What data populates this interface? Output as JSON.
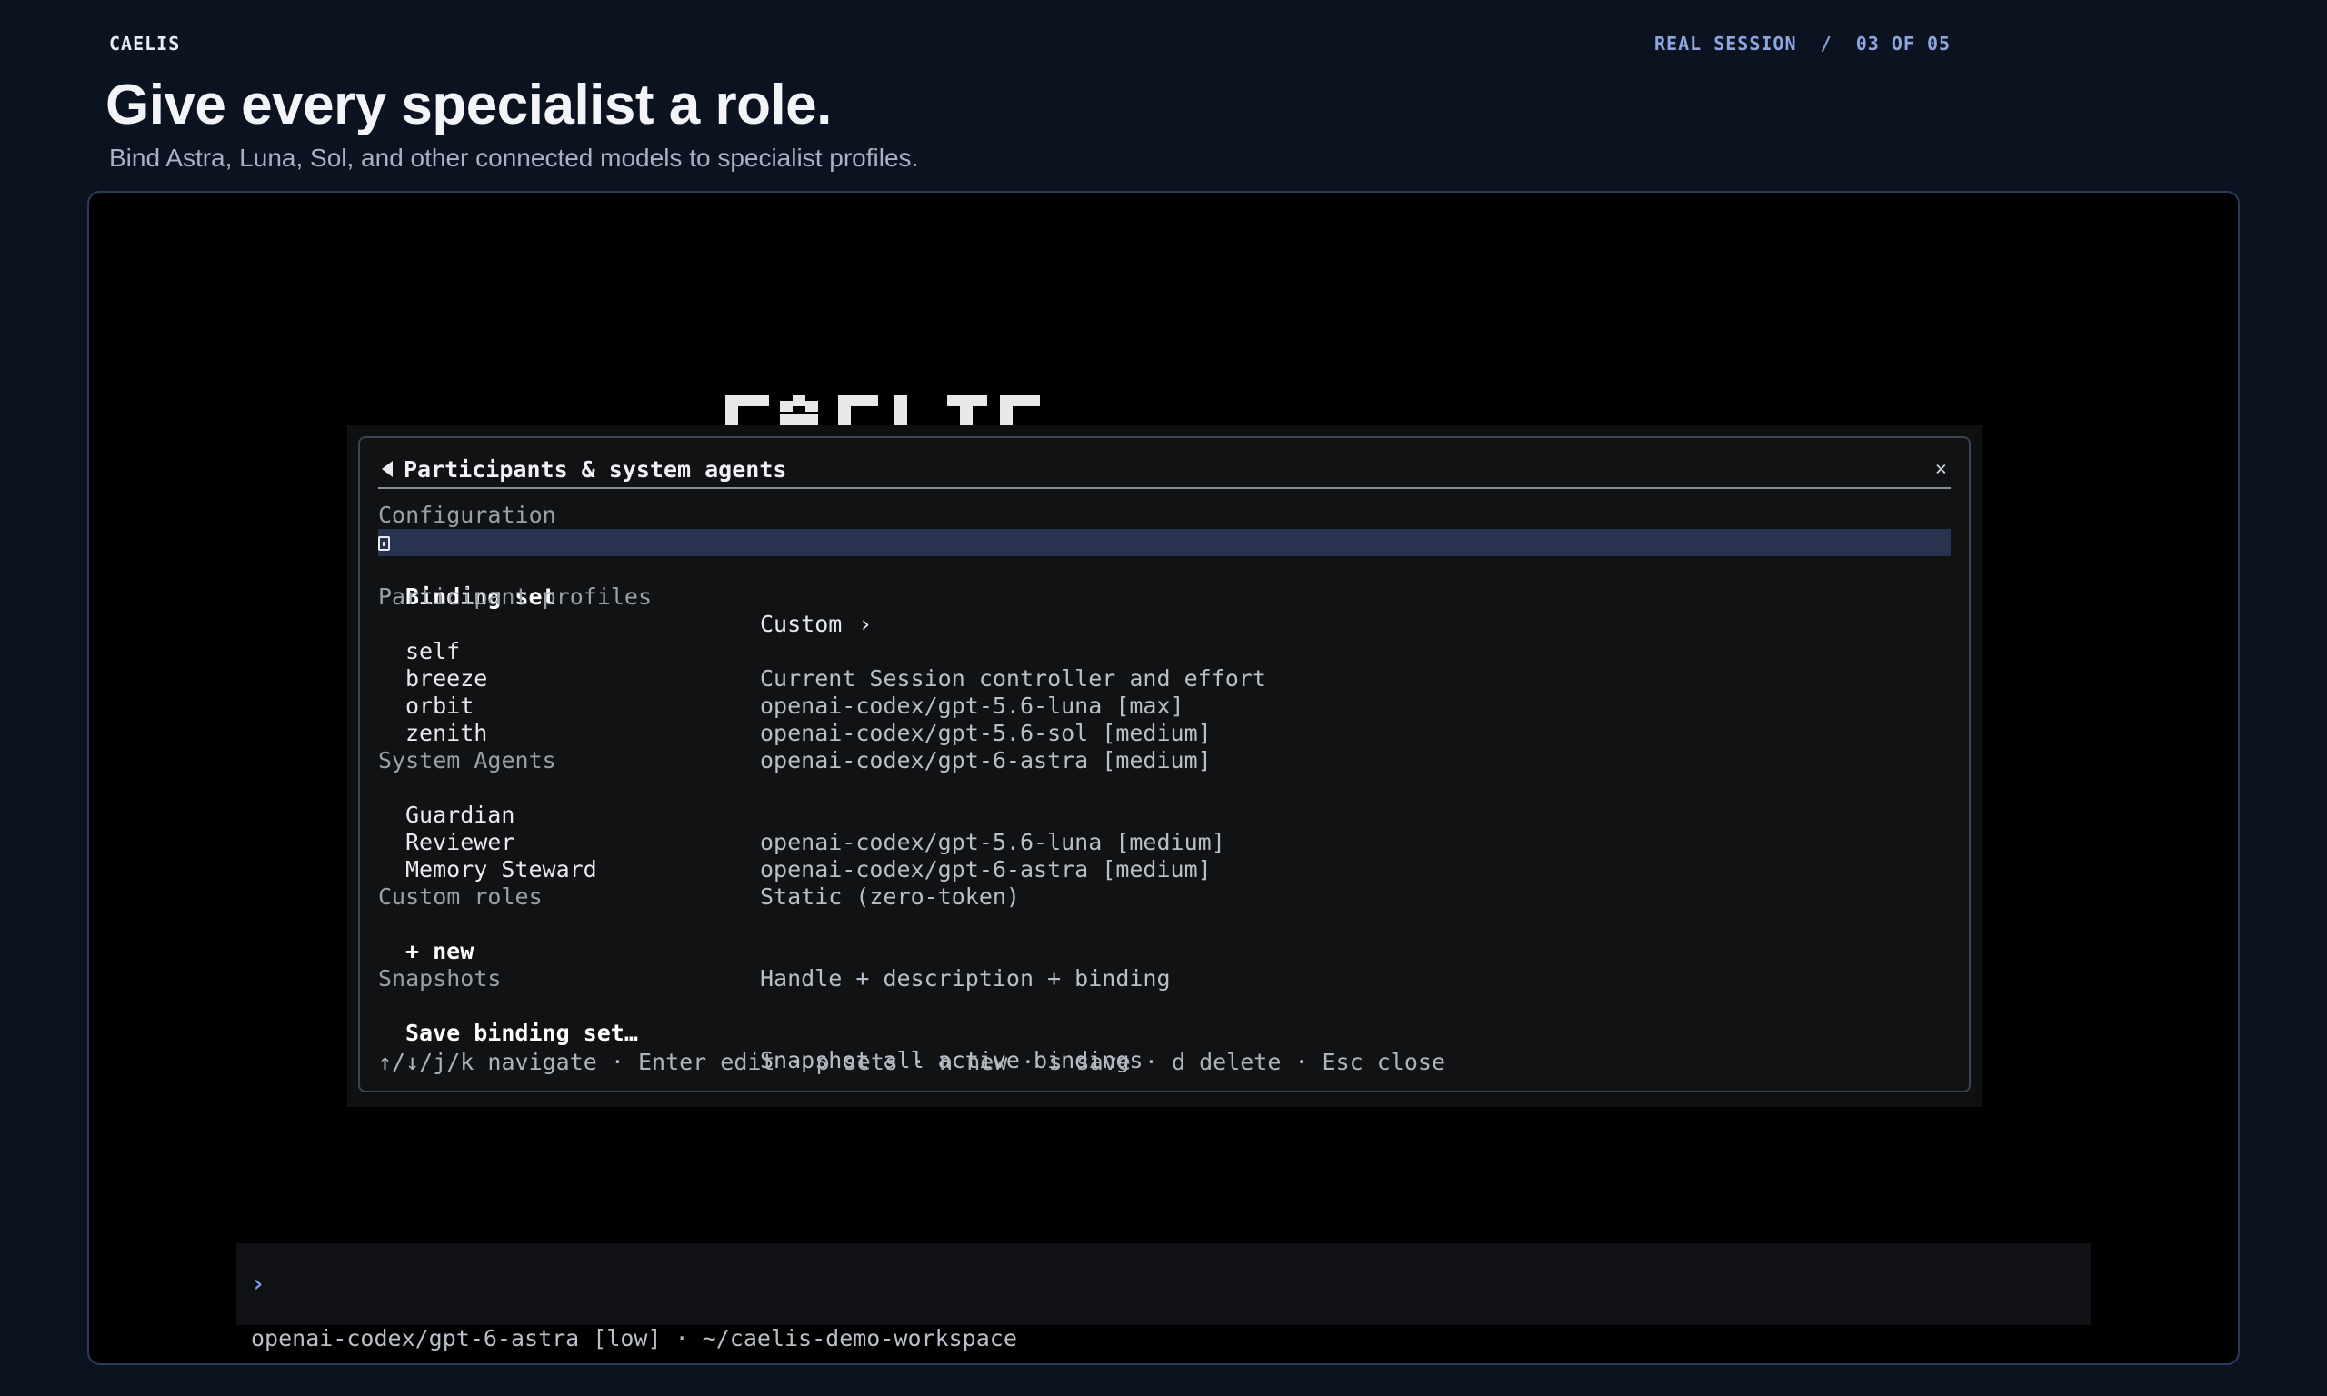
{
  "header": {
    "brand": "CAELIS",
    "progress": "REAL SESSION  /  03 OF 05",
    "title": "Give every specialist a role.",
    "subtitle": "Bind Astra, Luna, Sol, and other connected models to specialist profiles."
  },
  "modal": {
    "back_icon": "back-arrow-icon",
    "title": "Participants & system agents",
    "close_label": "×",
    "sections": {
      "configuration": {
        "label": "Configuration",
        "binding_set": {
          "icon": "binding-set-icon",
          "name": "Binding set",
          "value": "Custom",
          "chevron": "›"
        }
      },
      "participant_profiles": {
        "label": "Participant profiles",
        "items": [
          {
            "name": "self",
            "value": "Current Session controller and effort"
          },
          {
            "name": "breeze",
            "value": "openai-codex/gpt-5.6-luna [max]"
          },
          {
            "name": "orbit",
            "value": "openai-codex/gpt-5.6-sol [medium]"
          },
          {
            "name": "zenith",
            "value": "openai-codex/gpt-6-astra [medium]"
          }
        ]
      },
      "system_agents": {
        "label": "System Agents",
        "items": [
          {
            "name": "Guardian",
            "value": "openai-codex/gpt-5.6-luna [medium]"
          },
          {
            "name": "Reviewer",
            "value": "openai-codex/gpt-6-astra [medium]"
          },
          {
            "name": "Memory Steward",
            "value": "Static (zero-token)"
          }
        ]
      },
      "custom_roles": {
        "label": "Custom roles",
        "new": {
          "name": "+ new",
          "value": "Handle + description + binding"
        }
      },
      "snapshots": {
        "label": "Snapshots",
        "save": {
          "name": "Save binding set…",
          "value": "Snapshot all active bindings"
        }
      }
    },
    "hints": "↑/↓/j/k navigate · Enter edit · p sets · n new · s save · d delete · Esc close"
  },
  "prompt": {
    "caret": "›",
    "status": "openai-codex/gpt-6-astra [low] · ~/caelis-demo-workspace"
  },
  "colors": {
    "page_bg": "#0c1320",
    "terminal_bg": "#000000",
    "terminal_border": "#2b3a5c",
    "selection": "#283350",
    "accent": "#8fa5e0"
  }
}
